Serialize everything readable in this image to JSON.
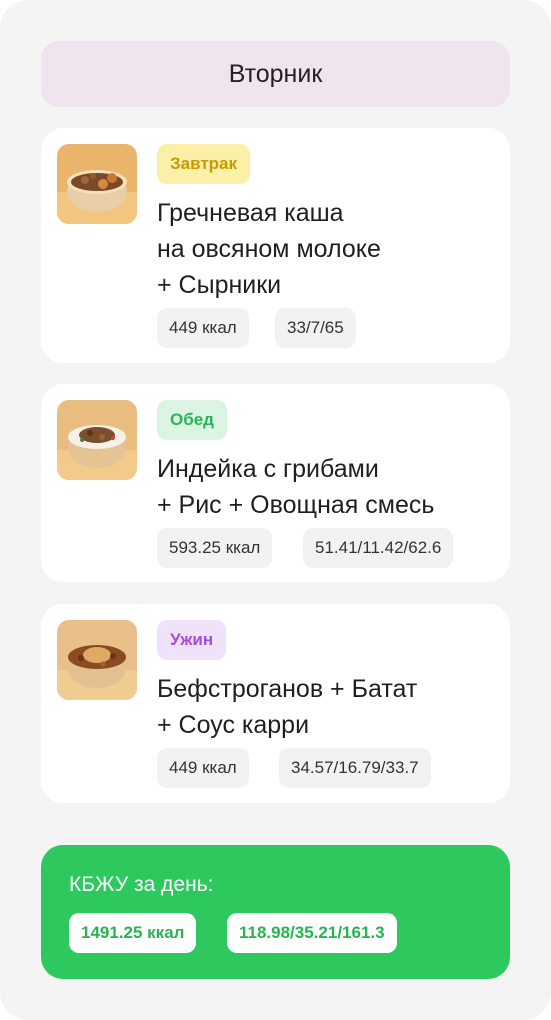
{
  "day": "Вторник",
  "meals": [
    {
      "tag": "Завтрак",
      "tag_bg": "#fcf0a8",
      "tag_color": "#c99a00",
      "title": "Гречневая каша\nна овсяном молоке\n+ Сырники",
      "kcal": "449 ккал",
      "macros": "33/7/65",
      "image_icon": "buckwheat-syrniki-bowl"
    },
    {
      "tag": "Обед",
      "tag_bg": "#dcf5e3",
      "tag_color": "#2ab35a",
      "title": "Индейка с грибами\n+ Рис + Овощная смесь",
      "kcal": "593.25 ккал",
      "macros": "51.41/11.42/62.6",
      "image_icon": "turkey-rice-bowl"
    },
    {
      "tag": "Ужин",
      "tag_bg": "#f0e2fb",
      "tag_color": "#a44be0",
      "title": "Бефстроганов + Батат\n+ Соус карри",
      "kcal": "449 ккал",
      "macros": "34.57/16.79/33.7",
      "image_icon": "beef-stroganoff-bowl"
    }
  ],
  "summary": {
    "title": "КБЖУ за день:",
    "kcal": "1491.25 ккал",
    "macros": "118.98/35.21/161.3",
    "bg": "#2ec95e"
  }
}
